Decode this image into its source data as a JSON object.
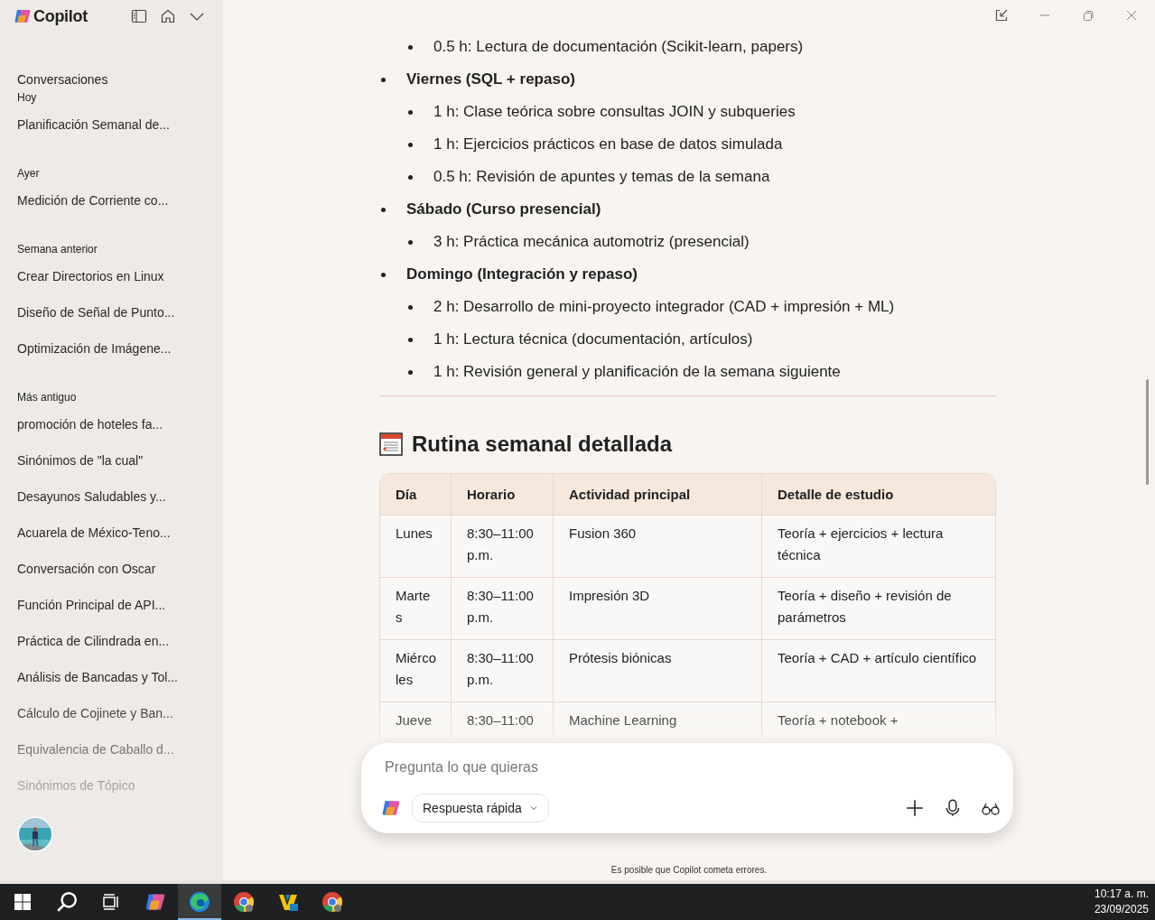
{
  "sidebar": {
    "app_name": "Copilot",
    "section_title": "Conversaciones",
    "groups": [
      {
        "label": "Hoy",
        "items": [
          {
            "title": "Planificación Semanal de..."
          }
        ]
      },
      {
        "label": "Ayer",
        "items": [
          {
            "title": "Medición de Corriente co..."
          }
        ]
      },
      {
        "label": "Semana anterior",
        "items": [
          {
            "title": "Crear Directorios en Linux"
          },
          {
            "title": "Diseño de Señal de Punto..."
          },
          {
            "title": "Optimización de Imágene..."
          }
        ]
      },
      {
        "label": "Más antiguo",
        "items": [
          {
            "title": "promoción de hoteles fa..."
          },
          {
            "title": "Sinónimos de \"la cual\""
          },
          {
            "title": "Desayunos Saludables y..."
          },
          {
            "title": "Acuarela de México-Teno..."
          },
          {
            "title": "Conversación con Oscar"
          },
          {
            "title": "Función Principal de API..."
          },
          {
            "title": "Práctica de Cilindrada en..."
          },
          {
            "title": "Análisis de Bancadas y Tol..."
          },
          {
            "title": "Cálculo de Cojinete y Ban..."
          },
          {
            "title": "Equivalencia de Caballo d..."
          },
          {
            "title": "Sinónimos de Tópico"
          }
        ]
      }
    ]
  },
  "content": {
    "outline": [
      {
        "children": [
          {
            "text": "0.5 h: Lectura de documentación (Scikit-learn, papers)"
          }
        ]
      },
      {
        "text": "Viernes (SQL + repaso)",
        "children": [
          {
            "text": "1 h: Clase teórica sobre consultas JOIN y subqueries"
          },
          {
            "text": "1 h: Ejercicios prácticos en base de datos simulada"
          },
          {
            "text": "0.5 h: Revisión de apuntes y temas de la semana"
          }
        ]
      },
      {
        "text": "Sábado (Curso presencial)",
        "children": [
          {
            "text": "3 h: Práctica mecánica automotriz (presencial)"
          }
        ]
      },
      {
        "text": "Domingo (Integración y repaso)",
        "children": [
          {
            "text": "2 h: Desarrollo de mini-proyecto integrador (CAD + impresión + ML)"
          },
          {
            "text": "1 h: Lectura técnica (documentación, artículos)"
          },
          {
            "text": "1 h: Revisión general y planificación de la semana siguiente"
          }
        ]
      }
    ],
    "heading": "Rutina semanal detallada",
    "table": {
      "columns": [
        "Día",
        "Horario",
        "Actividad principal",
        "Detalle de estudio"
      ],
      "rows": [
        [
          "Lunes",
          "8:30–11:00 p.m.",
          "Fusion 360",
          "Teoría + ejercicios + lectura técnica"
        ],
        [
          "Martes",
          "8:30–11:00 p.m.",
          "Impresión 3D",
          "Teoría + diseño + revisión de parámetros"
        ],
        [
          "Miércoles",
          "8:30–11:00 p.m.",
          "Prótesis biónicas",
          "Teoría + CAD + artículo científico"
        ],
        [
          "Jueve",
          "8:30–11:00",
          "Machine Learning",
          "Teoría + notebook +"
        ]
      ]
    }
  },
  "composer": {
    "placeholder": "Pregunta lo que quieras",
    "mode": "Respuesta rápida"
  },
  "disclaimer": "Es posible que Copilot cometa errores.",
  "taskbar": {
    "items": [
      {
        "kind": "start",
        "selected": false
      },
      {
        "kind": "search",
        "selected": false
      },
      {
        "kind": "taskview",
        "selected": false
      },
      {
        "kind": "copilot",
        "selected": false
      },
      {
        "kind": "edge",
        "selected": true
      },
      {
        "kind": "chrome",
        "selected": false
      },
      {
        "kind": "app",
        "selected": false
      },
      {
        "kind": "chrome",
        "selected": false
      }
    ],
    "time": "10:17 a. m.",
    "date": "23/09/2025"
  }
}
